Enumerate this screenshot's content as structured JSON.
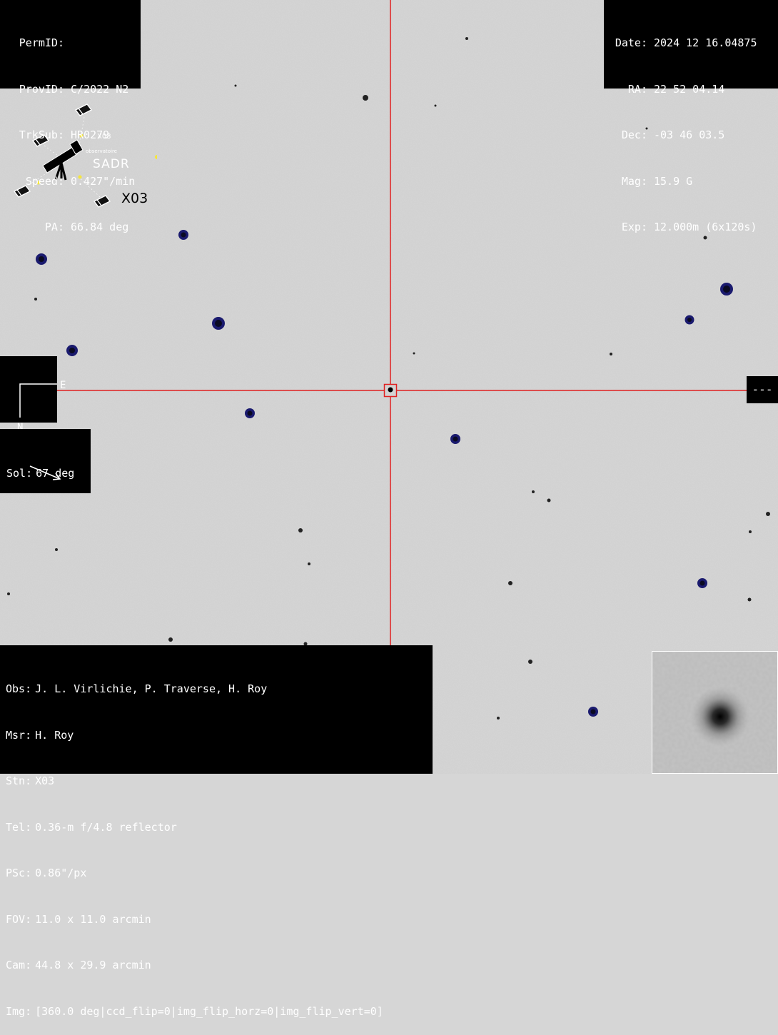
{
  "object_panel": {
    "rows": [
      {
        "label": "PermID:",
        "value": ""
      },
      {
        "label": "ProvID:",
        "value": "C/2022 N2"
      },
      {
        "label": "TrkSub:",
        "value": "HR0279"
      },
      {
        "label": "Speed:",
        "value": "0.427\"/min"
      },
      {
        "label": "PA:",
        "value": "66.84 deg"
      }
    ]
  },
  "date_panel": {
    "rows": [
      {
        "label": "Date:",
        "value": "2024 12 16.04875"
      },
      {
        "label": "RA:",
        "value": "22 52 04.14"
      },
      {
        "label": "Dec:",
        "value": "-03 46 03.5"
      },
      {
        "label": "Mag:",
        "value": "15.9 G"
      },
      {
        "label": "Exp:",
        "value": "12.000m (6x120s)"
      }
    ]
  },
  "orientation": {
    "east": "E",
    "north": "N"
  },
  "sol": {
    "label": "Sol:",
    "value": "67 deg"
  },
  "magnitude_tag": "---",
  "logo": {
    "station_small": "X03",
    "subtitle": "observatoire",
    "name": "SADR",
    "station": "X03"
  },
  "obs_panel": {
    "rows": [
      {
        "label": "Obs:",
        "value": "J. L. Virlichie, P. Traverse, H. Roy"
      },
      {
        "label": "Msr:",
        "value": "H. Roy"
      },
      {
        "label": "Stn:",
        "value": "X03"
      },
      {
        "label": "Tel:",
        "value": "0.36-m f/4.8 reflector"
      },
      {
        "label": "PSc:",
        "value": "0.86\"/px"
      },
      {
        "label": "FOV:",
        "value": "11.0 x 11.0 arcmin"
      },
      {
        "label": "Cam:",
        "value": "44.8 x 29.9 arcmin"
      },
      {
        "label": "Img:",
        "value": "[360.0 deg|ccd_flip=0|img_flip_horz=0|img_flip_vert=0]"
      }
    ]
  },
  "colors": {
    "sky_background": "#d6d6d6",
    "crosshair": "#e02020",
    "star_marker": "#1a1a6e",
    "panel_background": "#000000",
    "panel_text": "#ffffff"
  }
}
